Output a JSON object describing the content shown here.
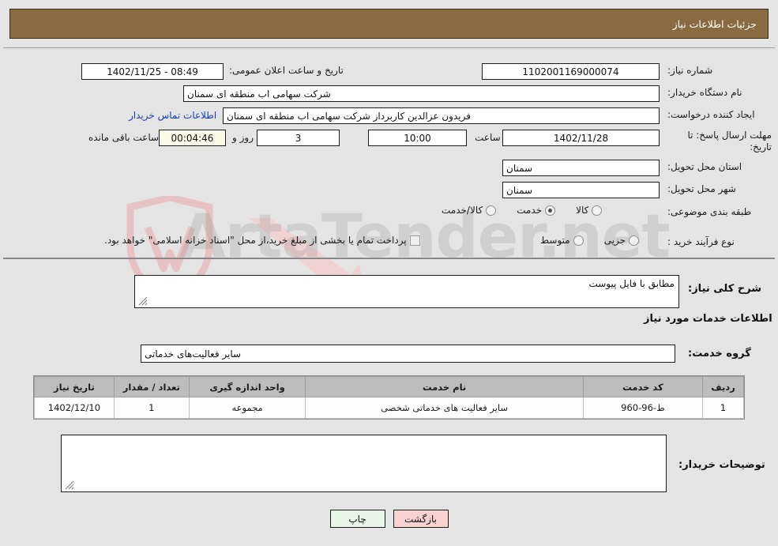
{
  "header": {
    "title": "جزئیات اطلاعات نیاز"
  },
  "form": {
    "need_number_label": "شماره نیاز:",
    "need_number_value": "1102001169000074",
    "announce_label": "تاریخ و ساعت اعلان عمومی:",
    "announce_value": "08:49 - 1402/11/25",
    "buyer_org_label": "نام دستگاه خریدار:",
    "buyer_org_value": "شرکت سهامی اب منطقه ای سمنان",
    "creator_label": "ایجاد کننده درخواست:",
    "creator_value": "فریدون عزالدین کاربرداز شرکت سهامی اب منطقه ای سمنان",
    "contact_link": "اطلاعات تماس خریدار",
    "deadline_label_line1": "مهلت ارسال پاسخ: تا",
    "deadline_label_line2": "تاریخ:",
    "deadline_date": "1402/11/28",
    "time_label": "ساعت",
    "time_value": "10:00",
    "days_value": "3",
    "days_label": "روز و",
    "countdown_value": "00:04:46",
    "countdown_label": "ساعت باقی مانده",
    "province_label": "استان محل تحویل:",
    "province_value": "سمنان",
    "city_label": "شهر محل تحویل:",
    "city_value": "سمنان",
    "category_label": "طبقه بندی موضوعی:",
    "category_options": [
      "کالا",
      "خدمت",
      "کالا/خدمت"
    ],
    "category_selected": "خدمت",
    "process_label": "نوع فرآیند خرید :",
    "process_options": [
      "جزیی",
      "متوسط"
    ],
    "process_selected": "",
    "treasury_checkbox_label": "پرداخت تمام یا بخشی از مبلغ خرید،از محل \"اسناد خزانه اسلامی\" خواهد بود.",
    "treasury_checked": false
  },
  "description": {
    "overall_need_label": "شرح کلی نیاز:",
    "overall_need_value": "مطابق با فایل پیوست",
    "services_info_title": "اطلاعات خدمات مورد نیاز",
    "service_group_label": "گروه خدمت:",
    "service_group_value": "سایر فعالیت‌های خدماتی"
  },
  "table": {
    "columns": [
      "ردیف",
      "کد خدمت",
      "نام خدمت",
      "واحد اندازه گیری",
      "تعداد / مقدار",
      "تاریخ نیاز"
    ],
    "rows": [
      {
        "row_no": "1",
        "service_code": "ط-96-960",
        "service_name": "سایر فعالیت های خدماتی شخصی",
        "unit": "مجموعه",
        "quantity": "1",
        "need_date": "1402/12/10"
      }
    ]
  },
  "buyer_notes": {
    "label": "توضیحات خریدار:",
    "value": ""
  },
  "footer": {
    "print_label": "چاپ",
    "back_label": "بازگشت"
  },
  "watermark": {
    "text": "ArtaTender.net"
  },
  "colors": {
    "header_bg": "#8a6a41",
    "page_bg": "#e4e4e4",
    "link": "#1341b9",
    "back_btn": "#fbd2d2",
    "print_btn": "#e8f6e8",
    "table_header": "#bdbdbd"
  }
}
